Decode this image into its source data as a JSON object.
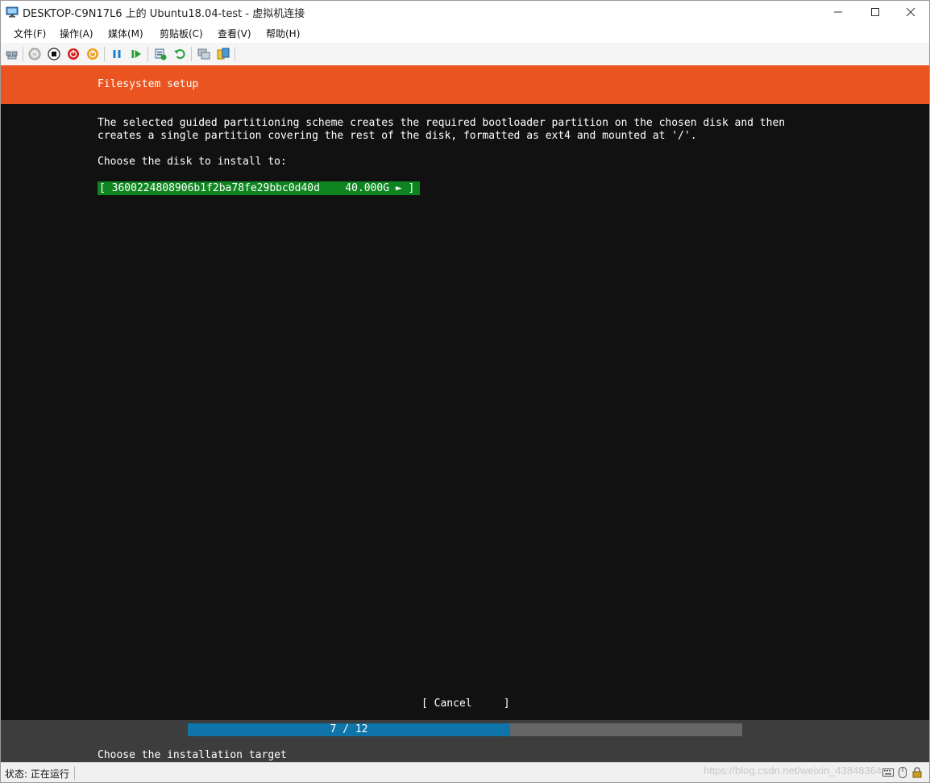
{
  "window": {
    "title": "DESKTOP-C9N17L6 上的 Ubuntu18.04-test - 虚拟机连接",
    "minimize_icon": "minimize-icon",
    "maximize_icon": "maximize-icon",
    "close_icon": "close-icon"
  },
  "menu": {
    "items": [
      {
        "label": "文件(F)"
      },
      {
        "label": "操作(A)"
      },
      {
        "label": "媒体(M)"
      },
      {
        "label": "剪贴板(C)"
      },
      {
        "label": "查看(V)"
      },
      {
        "label": "帮助(H)"
      }
    ]
  },
  "toolbar": {
    "icons": [
      "ctrl-alt-del-icon",
      "start-icon",
      "turn-off-icon",
      "shutdown-icon",
      "save-icon",
      "pause-icon",
      "resume-icon",
      "checkpoint-icon",
      "revert-icon",
      "enhanced-session-icon",
      "share-icon"
    ]
  },
  "installer": {
    "header_title": "Filesystem setup",
    "description_line1": "The selected guided partitioning scheme creates the required bootloader partition on the chosen disk and then",
    "description_line2": "creates a single partition covering the rest of the disk, formatted as ext4 and mounted at '/'.",
    "choose_label": "Choose the disk to install to:",
    "disk": {
      "bracket_open": "[ ",
      "name": "3600224808906b1f2ba78fe29bbc0d40d",
      "size": "40.000G",
      "arrow": "►",
      "bracket_close": " ]"
    },
    "cancel_button": "[ Cancel     ]",
    "progress": {
      "current": 7,
      "total": 12,
      "text": "7 / 12",
      "fill_fraction": 0.5814
    },
    "footer_hint": "Choose the installation target"
  },
  "status": {
    "text": "状态: 正在运行",
    "watermark": "https://blog.csdn.net/weixin_43848364"
  },
  "colors": {
    "header": "#e95420",
    "selected_row": "#0e8420",
    "progress_fill": "#0f74a8",
    "screen_bg": "#111111"
  }
}
